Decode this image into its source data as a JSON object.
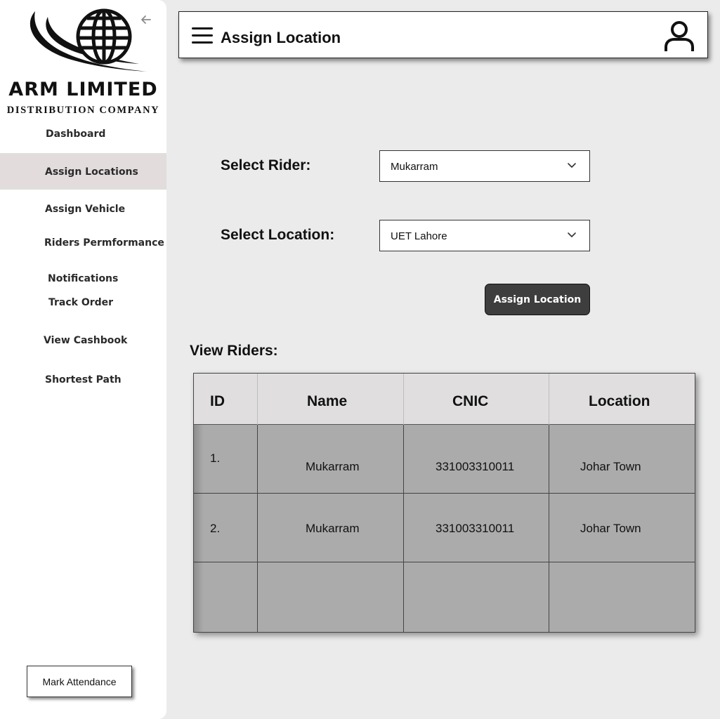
{
  "brand": {
    "name": "ARM LIMITED",
    "subtitle": "DISTRIBUTION COMPANY"
  },
  "sidebar": {
    "items": [
      {
        "label": "Dashboard"
      },
      {
        "label": "Assign Locations",
        "active": true
      },
      {
        "label": "Assign Vehicle"
      },
      {
        "label": "Riders Permformance"
      },
      {
        "label": "Notifications"
      },
      {
        "label": "Track Order"
      },
      {
        "label": "View Cashbook"
      },
      {
        "label": "Shortest Path"
      }
    ],
    "attendance_label": "Mark Attendance"
  },
  "header": {
    "title": "Assign Location"
  },
  "form": {
    "rider_label": "Select Rider:",
    "rider_value": "Mukarram",
    "location_label": "Select Location:",
    "location_value": "UET Lahore",
    "assign_button": "Assign Location"
  },
  "riders": {
    "title": "View Riders:",
    "columns": [
      "ID",
      "Name",
      "CNIC",
      "Location"
    ],
    "rows": [
      {
        "id": "1.",
        "name": "Mukarram",
        "cnic": "331003310011",
        "location": "Johar Town"
      },
      {
        "id": "2.",
        "name": "Mukarram",
        "cnic": "331003310011",
        "location": "Johar Town"
      }
    ]
  },
  "colors": {
    "background": "#ebebeb",
    "active_nav": "#e2dcdd",
    "button_dark": "#3e3e3e",
    "table_header": "#e0dede",
    "table_body": "#ababab"
  }
}
